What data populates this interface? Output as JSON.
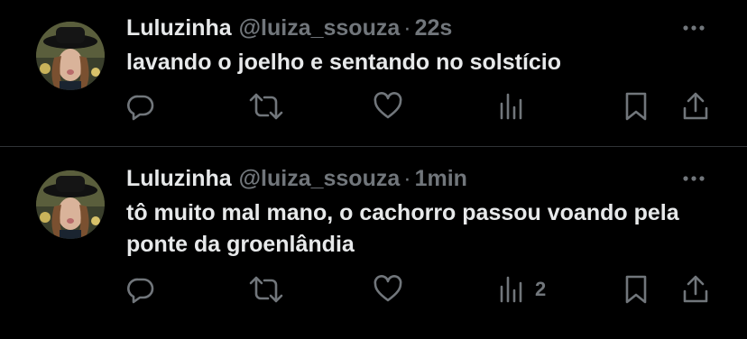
{
  "colors": {
    "background": "#000000",
    "text_primary": "#e7e9ea",
    "text_secondary": "#71767b",
    "divider": "#2f3336"
  },
  "tweets": [
    {
      "display_name": "Luluzinha",
      "handle": "@luiza_ssouza",
      "separator": "·",
      "time": "22s",
      "text": "lavando o joelho e sentando no solstício",
      "actions": {
        "reply_icon": "reply-icon",
        "retweet_icon": "retweet-icon",
        "like_icon": "heart-icon",
        "views_icon": "views-bar-chart-icon",
        "views_count": "",
        "bookmark_icon": "bookmark-icon",
        "share_icon": "share-icon"
      }
    },
    {
      "display_name": "Luluzinha",
      "handle": "@luiza_ssouza",
      "separator": "·",
      "time": "1min",
      "text": "tô muito mal mano, o cachorro passou voando pela ponte da groenlândia",
      "actions": {
        "reply_icon": "reply-icon",
        "retweet_icon": "retweet-icon",
        "like_icon": "heart-icon",
        "views_icon": "views-bar-chart-icon",
        "views_count": "2",
        "bookmark_icon": "bookmark-icon",
        "share_icon": "share-icon"
      }
    }
  ]
}
